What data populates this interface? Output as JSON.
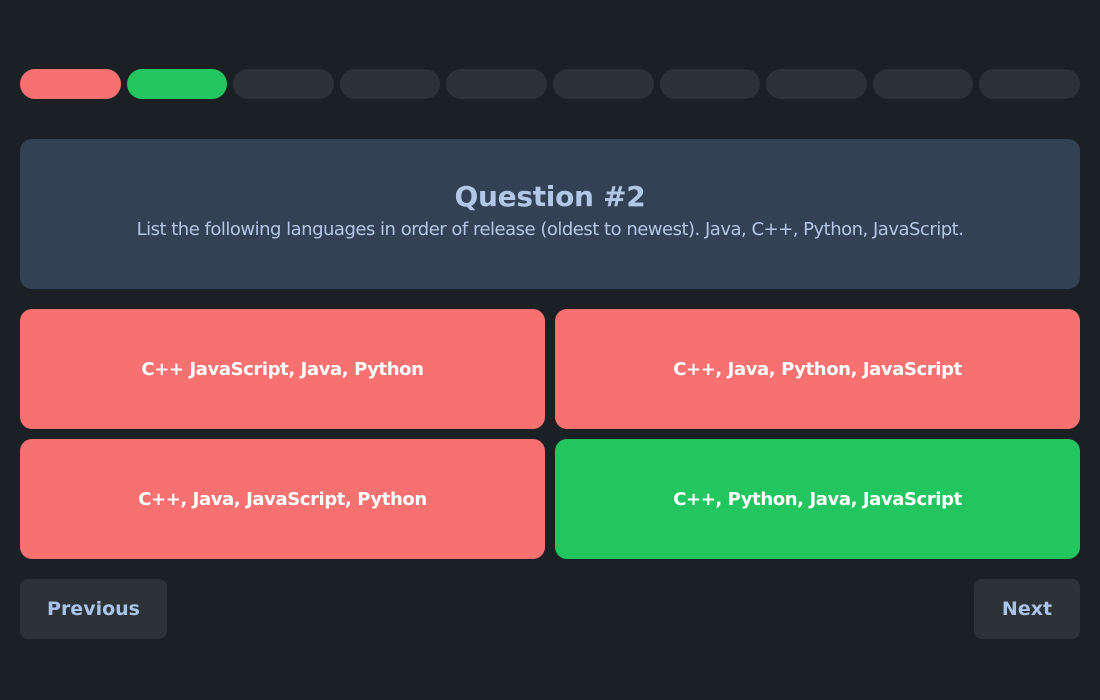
{
  "colors": {
    "background": "#1b2024",
    "incorrect": "#f87171",
    "correct": "#22c55e",
    "pending": "#2d3237",
    "card": "#334155",
    "text_accent": "#b2c7e6"
  },
  "progress": {
    "total": 10,
    "current": 2,
    "segments": [
      "incorrect",
      "correct",
      "pending",
      "pending",
      "pending",
      "pending",
      "pending",
      "pending",
      "pending",
      "pending"
    ]
  },
  "question": {
    "title": "Question #2",
    "text": "List the following languages in order of release (oldest to newest). Java, C++, Python, JavaScript."
  },
  "answers": [
    {
      "label": "C++ JavaScript, Java, Python",
      "state": "incorrect"
    },
    {
      "label": "C++, Java, Python, JavaScript",
      "state": "incorrect"
    },
    {
      "label": "C++, Java, JavaScript, Python",
      "state": "incorrect"
    },
    {
      "label": "C++, Python, Java, JavaScript",
      "state": "correct"
    }
  ],
  "nav": {
    "previous_label": "Previous",
    "next_label": "Next"
  }
}
